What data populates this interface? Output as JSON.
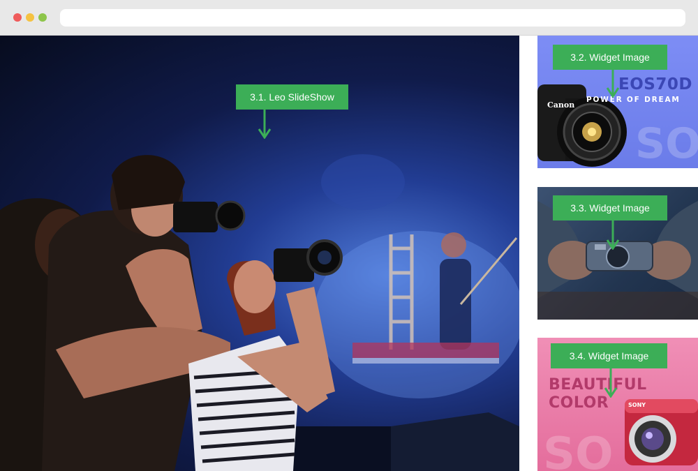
{
  "browser": {
    "window_controls": [
      "close",
      "minimize",
      "maximize"
    ],
    "address_bar_value": ""
  },
  "main_slideshow": {
    "callout_label": "3.1. Leo SlideShow",
    "image_description": "concert-photographers"
  },
  "widgets": [
    {
      "callout_label": "3.2. Widget Image",
      "ad_title": "EOS70D",
      "ad_subtitle": "POWER OF DREAM",
      "brand": "Canon",
      "watermark": "SON"
    },
    {
      "callout_label": "3.3. Widget Image"
    },
    {
      "callout_label": "3.4. Widget Image",
      "ad_line1": "BEAUTIFUL",
      "ad_line2": "COLOR",
      "brand": "SONY",
      "watermark": "SO"
    }
  ],
  "colors": {
    "callout_bg": "#3cae57",
    "callout_text": "#ffffff",
    "chrome_bg": "#e8e8e8",
    "dot_red": "#ef5b5b",
    "dot_yellow": "#f5c242",
    "dot_green": "#8dc54a"
  }
}
